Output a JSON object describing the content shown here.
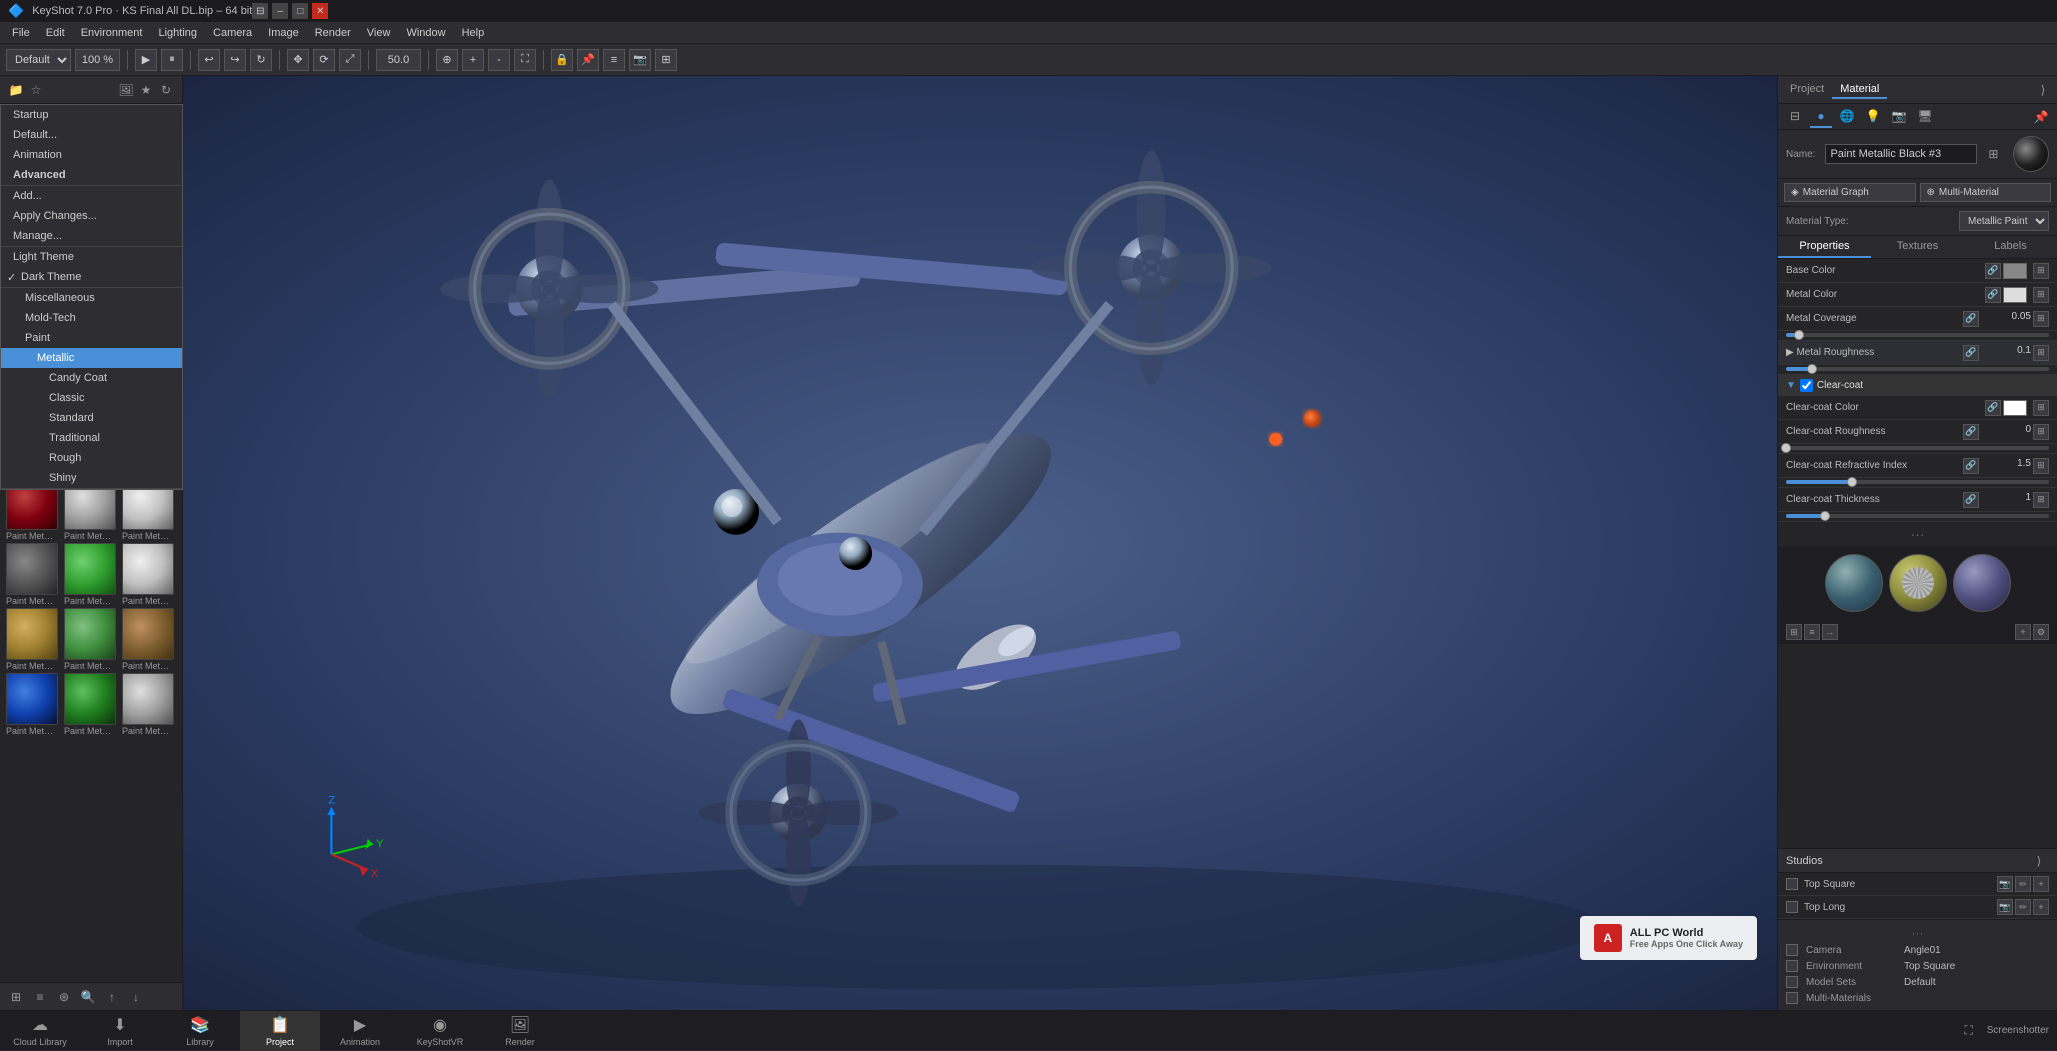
{
  "app": {
    "title": "KeyShot 7.0 Pro - KS Final All DL.bip - 64 bit",
    "icon": "ks-icon"
  },
  "titlebar": {
    "title": "KeyShot 7.0 Pro · KS Final All DL.bip – 64 bit",
    "min_btn": "–",
    "max_btn": "□",
    "close_btn": "✕"
  },
  "menubar": {
    "items": [
      "File",
      "Edit",
      "Environment",
      "Lighting",
      "Camera",
      "Image",
      "Render",
      "View",
      "Window",
      "Help"
    ]
  },
  "toolbar": {
    "preset_select": "Default",
    "zoom_input": "100 %",
    "render_value": "50.0"
  },
  "left_panel": {
    "header_icons": [
      "folder-icon",
      "star-icon",
      "image-icon",
      "reload-icon",
      "settings-icon"
    ],
    "dropdown": {
      "items": [
        {
          "label": "Startup",
          "indent": 0
        },
        {
          "label": "Default...",
          "indent": 0
        },
        {
          "label": "Animation",
          "indent": 0
        },
        {
          "label": "Advanced",
          "indent": 0
        },
        {
          "label": "Add...",
          "indent": 0
        },
        {
          "label": "Apply Changes...",
          "indent": 0
        },
        {
          "label": "Manage...",
          "indent": 0
        },
        {
          "label": "Light Theme",
          "indent": 0
        },
        {
          "label": "Dark Theme",
          "indent": 0,
          "checked": true
        },
        {
          "label": "Miscellaneous",
          "indent": 1
        },
        {
          "label": "Mold-Tech",
          "indent": 1
        },
        {
          "label": "Paint",
          "indent": 1
        },
        {
          "label": "Metallic",
          "indent": 2,
          "selected": true
        },
        {
          "label": "Candy Coat",
          "indent": 3
        },
        {
          "label": "Classic",
          "indent": 3
        },
        {
          "label": "Standard",
          "indent": 3
        },
        {
          "label": "Traditional",
          "indent": 3
        },
        {
          "label": "Rough",
          "indent": 3
        },
        {
          "label": "Shiny",
          "indent": 3
        }
      ]
    },
    "materials": [
      [
        {
          "label": "Paint Metal...",
          "type": "gold"
        },
        {
          "label": "Paint Metal...",
          "type": "black"
        },
        {
          "label": "Paint Metal...",
          "type": "blue"
        }
      ],
      [
        {
          "label": "Paint Metal...",
          "type": "blue2"
        },
        {
          "label": "Paint Metal...",
          "type": "green"
        },
        {
          "label": "Paint Metal...",
          "type": "red"
        }
      ],
      [
        {
          "label": "Paint Metal...",
          "type": "darkred"
        },
        {
          "label": "Paint Metal...",
          "type": "silver"
        },
        {
          "label": "Paint Metal...",
          "type": "chrome"
        }
      ],
      [
        {
          "label": "Paint Metal...",
          "type": "gray"
        },
        {
          "label": "Paint Metal...",
          "type": "green2"
        },
        {
          "label": "Paint Metal...",
          "type": "chrome"
        }
      ],
      [
        {
          "label": "Paint Metal...",
          "type": "tan"
        },
        {
          "label": "Paint Metal...",
          "type": "green3"
        },
        {
          "label": "Paint Metal...",
          "type": "brown"
        }
      ],
      [
        {
          "label": "Paint Metal...",
          "type": "blue2"
        },
        {
          "label": "Paint Metal...",
          "type": "green"
        },
        {
          "label": "Paint Metal...",
          "type": "silver"
        }
      ]
    ],
    "footer_label": "Cloud Library",
    "footer_icons": [
      "cloud-icon"
    ]
  },
  "right_panel": {
    "tabs": [
      {
        "label": "Project",
        "active": false
      },
      {
        "label": "Material",
        "active": true
      }
    ],
    "icon_tabs": [
      "sphere-icon",
      "circle-active-icon",
      "globe-icon",
      "bulb-icon",
      "camera-icon",
      "monitor-icon"
    ],
    "material": {
      "name": "Paint Metallic Black #3",
      "btn_material_graph": "Material Graph",
      "btn_multi_material": "Multi-Material",
      "type_label": "Material Type:",
      "type_value": "Metallic Paint",
      "sub_tabs": [
        "Properties",
        "Textures",
        "Labels"
      ],
      "active_sub_tab": "Properties",
      "properties": [
        {
          "label": "Base Color",
          "type": "color",
          "color": "#888888",
          "icons": [
            "link-icon",
            "texture-icon"
          ]
        },
        {
          "label": "Metal Color",
          "type": "color",
          "color": "#cccccc",
          "icons": [
            "link-icon",
            "texture-icon"
          ]
        },
        {
          "label": "Metal Coverage",
          "type": "value",
          "value": "0.05",
          "icons": [
            "link-icon",
            "texture-icon"
          ]
        },
        {
          "label": "Metal Roughness",
          "type": "section",
          "value": "0.1",
          "collapsed": false
        },
        {
          "label": "Clear-coat",
          "type": "section_header",
          "checked": true
        }
      ],
      "clearcoat": {
        "color": "#ffffff",
        "roughness": "0",
        "refractive_index": "1.5",
        "thickness": "1",
        "roughness_slider_pct": 0,
        "thickness_slider_pct": 15
      },
      "preview_spheres": [
        {
          "type": "env1"
        },
        {
          "type": "env2"
        },
        {
          "type": "env3"
        }
      ],
      "preview_icons": [
        "grid-icon",
        "grid2-icon",
        "arrow-icon",
        "add-icon",
        "settings-icon"
      ]
    },
    "studios": {
      "label": "Studios",
      "items": [
        {
          "label": "Top Square"
        },
        {
          "label": "Top Long"
        }
      ]
    },
    "render_info": {
      "sep_label": "...",
      "rows": [
        {
          "label": "Camera",
          "value": "Angle01"
        },
        {
          "label": "Environment",
          "value": "Top Square"
        },
        {
          "label": "Model Sets",
          "value": "Default"
        },
        {
          "label": "Multi-Materials",
          "value": ""
        }
      ]
    }
  },
  "bottom_tabs": [
    {
      "label": "Cloud Library",
      "icon": "☁",
      "active": false
    },
    {
      "label": "Import",
      "icon": "⬇",
      "active": false
    },
    {
      "label": "Library",
      "icon": "📚",
      "active": false
    },
    {
      "label": "Project",
      "icon": "📋",
      "active": true
    },
    {
      "label": "Animation",
      "icon": "▶",
      "active": false
    },
    {
      "label": "KeyShotVR",
      "icon": "◉",
      "active": false
    },
    {
      "label": "Render",
      "icon": "🖼",
      "active": false
    }
  ],
  "viewport": {
    "screenshot_btn": "Screenshot",
    "fps_label": "Screenshotter"
  }
}
